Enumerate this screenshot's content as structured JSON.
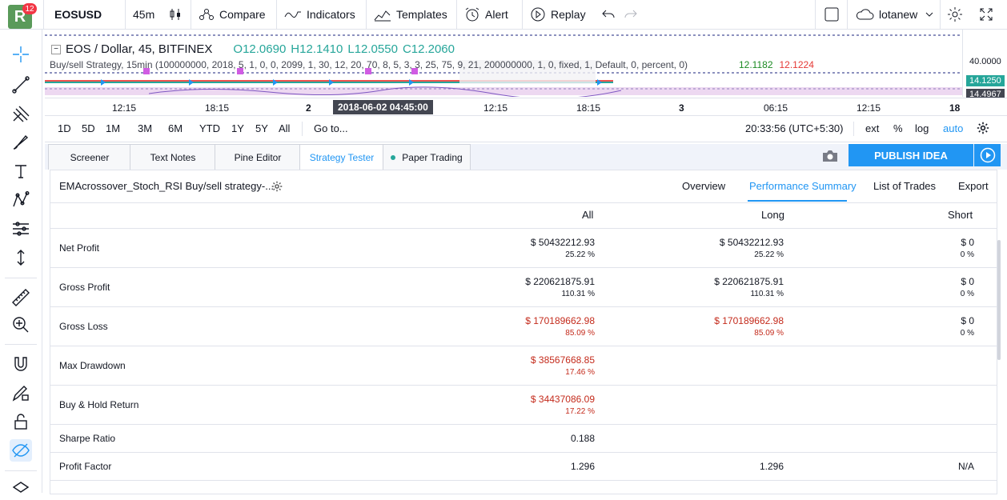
{
  "header": {
    "badge": "12",
    "avatar_letter": "R",
    "symbol": "EOSUSD",
    "interval": "45m",
    "compare": "Compare",
    "indicators": "Indicators",
    "templates": "Templates",
    "alert": "Alert",
    "replay": "Replay",
    "user": "lotanew"
  },
  "chart": {
    "legend_title": "EOS / Dollar, 45, BITFINEX",
    "ohlc": {
      "o": "O12.0690",
      "h": "H12.1410",
      "l": "L12.0550",
      "c": "C12.2060"
    },
    "strategy_line": "Buy/sell Strategy, 15min (100000000, 2018, 5, 1, 0, 0, 2099, 1, 30, 12, 20, 70, 8, 5, 3, 3, 25, 75, 9, 21, 200000000, 1, 0, fixed, 1, Default, 0, percent, 0)",
    "strategy_val_1": "12.1182",
    "strategy_val_2": "12.1224",
    "price_labels": {
      "p1": "40.0000",
      "p2": "14.1250",
      "p3": "14.4967"
    },
    "time_labels": [
      "12:15",
      "18:15",
      "2",
      "12:15",
      "18:15",
      "3",
      "06:15",
      "12:15",
      "18"
    ],
    "crosshair_time": "2018-06-02 04:45:00"
  },
  "range_bar": {
    "ranges": [
      "1D",
      "5D",
      "1M",
      "3M",
      "6M",
      "YTD",
      "1Y",
      "5Y",
      "All"
    ],
    "goto": "Go to...",
    "clock": "20:33:56 (UTC+5:30)",
    "ext": "ext",
    "percent": "%",
    "log": "log",
    "auto": "auto"
  },
  "bottom_tabs": [
    "Screener",
    "Text Notes",
    "Pine Editor",
    "Strategy Tester",
    "Paper Trading"
  ],
  "publish": "PUBLISH IDEA",
  "tester": {
    "strategy_name": "EMAcrossover_Stoch_RSI Buy/sell strategy-...",
    "tabs": [
      "Overview",
      "Performance Summary",
      "List of Trades",
      "Export"
    ],
    "columns": [
      "All",
      "Long",
      "Short"
    ],
    "rows": [
      {
        "label": "Net Profit",
        "all": "$ 50432212.93",
        "all_pct": "25.22 %",
        "long": "$ 50432212.93",
        "long_pct": "25.22 %",
        "short": "$ 0",
        "short_pct": "0 %"
      },
      {
        "label": "Gross Profit",
        "all": "$ 220621875.91",
        "all_pct": "110.31 %",
        "long": "$ 220621875.91",
        "long_pct": "110.31 %",
        "short": "$ 0",
        "short_pct": "0 %"
      },
      {
        "label": "Gross Loss",
        "all": "$ 170189662.98",
        "all_pct": "85.09 %",
        "long": "$ 170189662.98",
        "long_pct": "85.09 %",
        "short": "$ 0",
        "short_pct": "0 %"
      },
      {
        "label": "Max Drawdown",
        "all": "$ 38567668.85",
        "all_pct": "17.46 %"
      },
      {
        "label": "Buy & Hold Return",
        "all": "$ 34437086.09",
        "all_pct": "17.22 %"
      },
      {
        "label": "Sharpe Ratio",
        "all": "0.188"
      },
      {
        "label": "Profit Factor",
        "all": "1.296",
        "long": "1.296",
        "short": "N/A"
      }
    ]
  },
  "colors": {
    "accent": "#2196f3",
    "negative": "#c42b1c",
    "up": "#26a69a",
    "down": "#ef5350"
  }
}
